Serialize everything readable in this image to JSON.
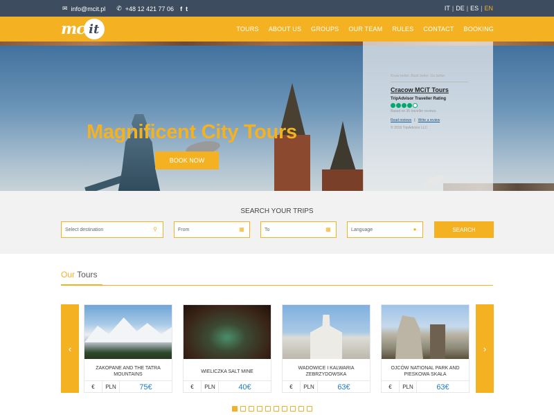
{
  "topbar": {
    "email": "info@mcit.pl",
    "phone": "+48 12 421 77 06",
    "social": [
      "f",
      "t"
    ],
    "languages": [
      "IT",
      "DE",
      "ES",
      "EN"
    ],
    "active_language": "EN"
  },
  "logo": {
    "part1": "mc",
    "part2": "it"
  },
  "nav": [
    "TOURS",
    "ABOUT US",
    "GROUPS",
    "OUR TEAM",
    "RULES",
    "CONTACT",
    "BOOKING"
  ],
  "hero": {
    "title": "Magnificent City Tours",
    "button": "BOOK NOW"
  },
  "tripadvisor": {
    "tagline": "Know better. Book better. Go better.",
    "title": "Cracow MCiT Tours",
    "rating_label": "TripAdvisor Traveller Rating",
    "bubbles_filled": 4,
    "bubbles_total": 5,
    "based_on": "Based on 35 traveller reviews",
    "read_reviews": "Read reviews",
    "write_review": "Write a review",
    "copyright": "© 2019 TripAdvisor LLC"
  },
  "search": {
    "title": "SEARCH YOUR TRIPS",
    "destination_placeholder": "Select destination",
    "from_placeholder": "From",
    "to_placeholder": "To",
    "language_placeholder": "Language",
    "button": "SEARCH"
  },
  "tours_section": {
    "heading_light": "Our",
    "heading_bold": "Tours",
    "tours": [
      {
        "name": "ZAKOPANE AND THE TATRA MOUNTAINS",
        "currency_symbol": "€",
        "currency_alt": "PLN",
        "price": "75€"
      },
      {
        "name": "WIELICZKA SALT MINE",
        "currency_symbol": "€",
        "currency_alt": "PLN",
        "price": "40€"
      },
      {
        "name": "WADOWICE I KALWARIA ZEBRZYDOWSKA",
        "currency_symbol": "€",
        "currency_alt": "PLN",
        "price": "63€"
      },
      {
        "name": "OJCÓW NATIONAL PARK AND PIESKOWA SKAŁA",
        "currency_symbol": "€",
        "currency_alt": "PLN",
        "price": "63€"
      }
    ],
    "arrow_prev": "‹",
    "arrow_next": "›",
    "pages_total": 10,
    "active_page": 1
  },
  "colors": {
    "accent": "#f4b223",
    "topbar": "#3d4c5f",
    "price": "#1e7bc4"
  }
}
